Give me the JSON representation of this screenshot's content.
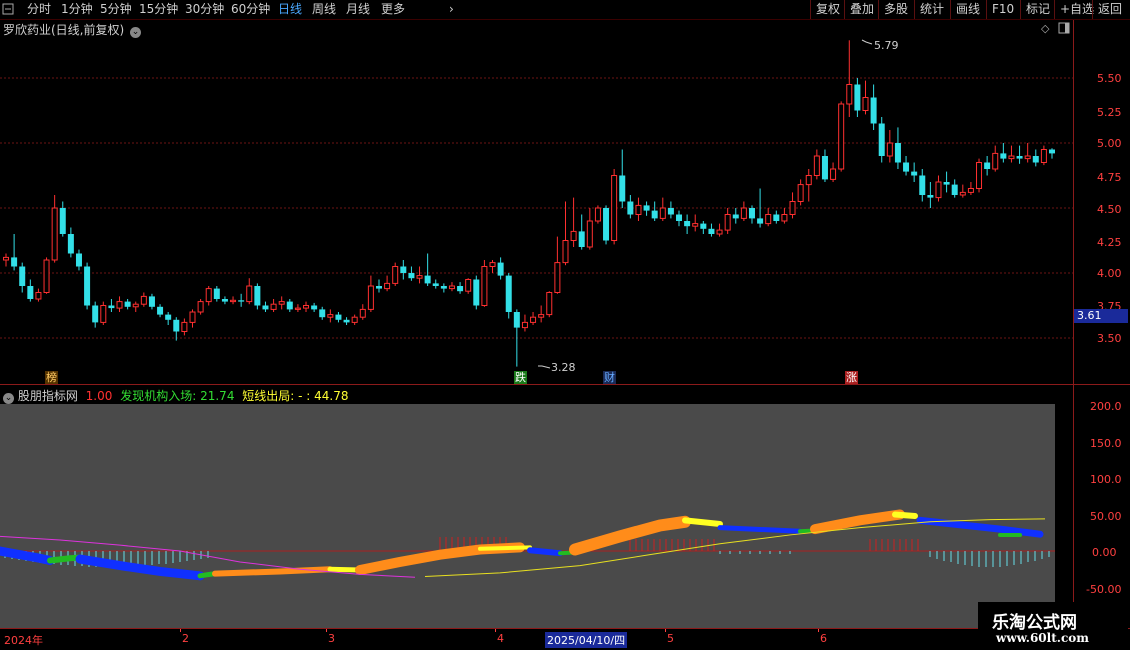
{
  "toolbar": {
    "left_items": [
      "分时",
      "1分钟",
      "5分钟",
      "15分钟",
      "30分钟",
      "60分钟",
      "日线",
      "周线",
      "月线",
      "更多"
    ],
    "active": "日线",
    "right_items": [
      "复权",
      "叠加",
      "多股",
      "统计",
      "画线",
      "F10",
      "标记",
      "+自选",
      "返回"
    ]
  },
  "main_chart": {
    "title": "罗欣药业(日线,前复权)",
    "y_ticks": [
      "5.50",
      "5.25",
      "5.00",
      "4.75",
      "4.50",
      "4.25",
      "4.00",
      "3.75",
      "3.50"
    ],
    "current_price": "3.61",
    "high_label": "5.79",
    "low_label": "3.28",
    "markers": [
      {
        "text": "榜",
        "color": "#ffcc66",
        "bg": "#553300"
      },
      {
        "text": "跌",
        "color": "#ffffff",
        "bg": "#1a7a1a"
      },
      {
        "text": "财",
        "color": "#66aaff",
        "bg": "#1a2a55"
      },
      {
        "text": "涨",
        "color": "#ffffff",
        "bg": "#aa2020"
      }
    ]
  },
  "indicator": {
    "name": "股朋指标网",
    "value1": "1.00",
    "label2": "发现机构入场:",
    "value2": "21.74",
    "label3": "短线出局:",
    "value3": "- : 44.78",
    "y_ticks": [
      "200.0",
      "150.0",
      "100.0",
      "50.00",
      "0.00",
      "-50.00"
    ]
  },
  "x_axis": {
    "labels": [
      "2024年",
      "2",
      "3",
      "4",
      "2025/04/10/四",
      "5",
      "6"
    ]
  },
  "watermark": {
    "line1": "乐淘公式网",
    "line2": "www.60lt.com"
  },
  "colors": {
    "up": "#ff3030",
    "down": "#33e0e8",
    "grid": "#6b1414",
    "axis_text": "#ff4040",
    "active_tab": "#4aa8ff"
  },
  "chart_data": {
    "type": "candlestick",
    "title": "罗欣药业(日线,前复权)",
    "ylim": [
      3.3,
      5.9
    ],
    "candles": [
      [
        4.1,
        4.12,
        4.05,
        4.15
      ],
      [
        4.12,
        4.05,
        4.02,
        4.3
      ],
      [
        4.05,
        3.9,
        3.85,
        4.08
      ],
      [
        3.9,
        3.8,
        3.78,
        3.95
      ],
      [
        3.8,
        3.85,
        3.78,
        3.88
      ],
      [
        3.85,
        4.1,
        3.84,
        4.12
      ],
      [
        4.1,
        4.5,
        4.08,
        4.6
      ],
      [
        4.5,
        4.3,
        4.28,
        4.55
      ],
      [
        4.3,
        4.15,
        4.12,
        4.35
      ],
      [
        4.15,
        4.05,
        4.02,
        4.18
      ],
      [
        4.05,
        3.75,
        3.72,
        4.08
      ],
      [
        3.75,
        3.62,
        3.58,
        3.78
      ],
      [
        3.62,
        3.75,
        3.6,
        3.78
      ],
      [
        3.75,
        3.73,
        3.7,
        3.8
      ],
      [
        3.73,
        3.78,
        3.7,
        3.82
      ],
      [
        3.78,
        3.74,
        3.72,
        3.8
      ],
      [
        3.74,
        3.76,
        3.7,
        3.78
      ],
      [
        3.76,
        3.82,
        3.74,
        3.85
      ],
      [
        3.82,
        3.74,
        3.72,
        3.84
      ],
      [
        3.74,
        3.68,
        3.66,
        3.76
      ],
      [
        3.68,
        3.64,
        3.6,
        3.7
      ],
      [
        3.64,
        3.55,
        3.48,
        3.66
      ],
      [
        3.55,
        3.62,
        3.52,
        3.65
      ],
      [
        3.62,
        3.7,
        3.58,
        3.72
      ],
      [
        3.7,
        3.78,
        3.68,
        3.8
      ],
      [
        3.78,
        3.88,
        3.75,
        3.9
      ],
      [
        3.88,
        3.8,
        3.78,
        3.9
      ],
      [
        3.8,
        3.78,
        3.76,
        3.82
      ],
      [
        3.78,
        3.79,
        3.76,
        3.82
      ],
      [
        3.79,
        3.78,
        3.74,
        3.84
      ],
      [
        3.78,
        3.9,
        3.76,
        3.96
      ],
      [
        3.9,
        3.75,
        3.72,
        3.92
      ],
      [
        3.75,
        3.72,
        3.7,
        3.78
      ],
      [
        3.72,
        3.76,
        3.7,
        3.8
      ],
      [
        3.76,
        3.78,
        3.72,
        3.82
      ],
      [
        3.78,
        3.72,
        3.7,
        3.8
      ],
      [
        3.72,
        3.73,
        3.7,
        3.76
      ],
      [
        3.73,
        3.75,
        3.7,
        3.78
      ],
      [
        3.75,
        3.72,
        3.7,
        3.77
      ],
      [
        3.72,
        3.66,
        3.64,
        3.74
      ],
      [
        3.66,
        3.68,
        3.62,
        3.72
      ],
      [
        3.68,
        3.64,
        3.62,
        3.7
      ],
      [
        3.64,
        3.62,
        3.6,
        3.66
      ],
      [
        3.62,
        3.66,
        3.6,
        3.68
      ],
      [
        3.66,
        3.72,
        3.64,
        3.76
      ],
      [
        3.72,
        3.9,
        3.7,
        3.98
      ],
      [
        3.9,
        3.88,
        3.85,
        3.95
      ],
      [
        3.88,
        3.92,
        3.86,
        3.98
      ],
      [
        3.92,
        4.05,
        3.9,
        4.08
      ],
      [
        4.05,
        4.0,
        3.95,
        4.1
      ],
      [
        4.0,
        3.96,
        3.94,
        4.05
      ],
      [
        3.96,
        3.98,
        3.92,
        4.05
      ],
      [
        3.98,
        3.92,
        3.9,
        4.15
      ],
      [
        3.92,
        3.9,
        3.88,
        3.95
      ],
      [
        3.9,
        3.88,
        3.85,
        3.92
      ],
      [
        3.88,
        3.9,
        3.86,
        3.93
      ],
      [
        3.9,
        3.86,
        3.84,
        3.93
      ],
      [
        3.86,
        3.95,
        3.84,
        3.96
      ],
      [
        3.95,
        3.75,
        3.72,
        3.98
      ],
      [
        3.75,
        4.05,
        3.74,
        4.1
      ],
      [
        4.05,
        4.08,
        4.0,
        4.1
      ],
      [
        4.08,
        3.98,
        3.95,
        4.12
      ],
      [
        3.98,
        3.7,
        3.65,
        4.0
      ],
      [
        3.7,
        3.58,
        3.28,
        3.72
      ],
      [
        3.58,
        3.62,
        3.55,
        3.68
      ],
      [
        3.62,
        3.66,
        3.6,
        3.7
      ],
      [
        3.66,
        3.68,
        3.62,
        3.75
      ],
      [
        3.68,
        3.85,
        3.66,
        3.86
      ],
      [
        3.85,
        4.08,
        3.84,
        4.28
      ],
      [
        4.08,
        4.25,
        4.06,
        4.55
      ],
      [
        4.25,
        4.32,
        4.2,
        4.58
      ],
      [
        4.32,
        4.2,
        4.18,
        4.45
      ],
      [
        4.2,
        4.4,
        4.18,
        4.5
      ],
      [
        4.4,
        4.5,
        4.38,
        4.52
      ],
      [
        4.5,
        4.25,
        4.22,
        4.52
      ],
      [
        4.25,
        4.75,
        4.22,
        4.8
      ],
      [
        4.75,
        4.55,
        4.5,
        4.95
      ],
      [
        4.55,
        4.45,
        4.42,
        4.6
      ],
      [
        4.45,
        4.52,
        4.4,
        4.58
      ],
      [
        4.52,
        4.48,
        4.44,
        4.55
      ],
      [
        4.48,
        4.42,
        4.4,
        4.55
      ],
      [
        4.42,
        4.5,
        4.4,
        4.58
      ],
      [
        4.5,
        4.45,
        4.42,
        4.55
      ],
      [
        4.45,
        4.4,
        4.36,
        4.48
      ],
      [
        4.4,
        4.36,
        4.3,
        4.45
      ],
      [
        4.36,
        4.38,
        4.32,
        4.45
      ],
      [
        4.38,
        4.34,
        4.3,
        4.4
      ],
      [
        4.34,
        4.3,
        4.28,
        4.38
      ],
      [
        4.3,
        4.33,
        4.28,
        4.38
      ],
      [
        4.33,
        4.45,
        4.3,
        4.5
      ],
      [
        4.45,
        4.42,
        4.38,
        4.5
      ],
      [
        4.42,
        4.5,
        4.4,
        4.55
      ],
      [
        4.5,
        4.42,
        4.38,
        4.52
      ],
      [
        4.42,
        4.38,
        4.35,
        4.65
      ],
      [
        4.38,
        4.45,
        4.36,
        4.5
      ],
      [
        4.45,
        4.4,
        4.38,
        4.48
      ],
      [
        4.4,
        4.45,
        4.38,
        4.5
      ],
      [
        4.45,
        4.55,
        4.42,
        4.62
      ],
      [
        4.55,
        4.68,
        4.52,
        4.72
      ],
      [
        4.68,
        4.75,
        4.55,
        4.8
      ],
      [
        4.75,
        4.9,
        4.72,
        4.95
      ],
      [
        4.9,
        4.72,
        4.7,
        4.95
      ],
      [
        4.72,
        4.8,
        4.7,
        4.85
      ],
      [
        4.8,
        5.3,
        4.78,
        5.32
      ],
      [
        5.3,
        5.45,
        5.2,
        5.79
      ],
      [
        5.45,
        5.25,
        5.2,
        5.5
      ],
      [
        5.25,
        5.35,
        5.22,
        5.48
      ],
      [
        5.35,
        5.15,
        5.1,
        5.45
      ],
      [
        5.15,
        4.9,
        4.85,
        5.2
      ],
      [
        4.9,
        5.0,
        4.85,
        5.1
      ],
      [
        5.0,
        4.85,
        4.8,
        5.12
      ],
      [
        4.85,
        4.78,
        4.75,
        4.9
      ],
      [
        4.78,
        4.75,
        4.7,
        4.85
      ],
      [
        4.75,
        4.6,
        4.55,
        4.8
      ],
      [
        4.6,
        4.58,
        4.5,
        4.7
      ],
      [
        4.58,
        4.7,
        4.55,
        4.75
      ],
      [
        4.7,
        4.68,
        4.62,
        4.78
      ],
      [
        4.68,
        4.6,
        4.58,
        4.72
      ],
      [
        4.6,
        4.62,
        4.58,
        4.68
      ],
      [
        4.62,
        4.65,
        4.6,
        4.7
      ],
      [
        4.65,
        4.85,
        4.62,
        4.88
      ],
      [
        4.85,
        4.8,
        4.75,
        4.9
      ],
      [
        4.8,
        4.92,
        4.78,
        4.98
      ],
      [
        4.92,
        4.88,
        4.85,
        5.0
      ],
      [
        4.88,
        4.9,
        4.85,
        4.98
      ],
      [
        4.9,
        4.88,
        4.84,
        4.98
      ],
      [
        4.88,
        4.9,
        4.85,
        5.0
      ],
      [
        4.9,
        4.85,
        4.82,
        4.95
      ],
      [
        4.85,
        4.95,
        4.83,
        4.98
      ],
      [
        4.95,
        4.92,
        4.88,
        4.96
      ]
    ]
  }
}
